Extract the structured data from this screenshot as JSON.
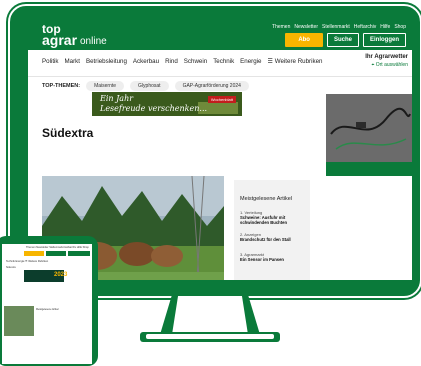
{
  "site": {
    "logo_top": "top",
    "logo_agrar": "agrar",
    "logo_online": "online",
    "top_links": [
      "Themen",
      "Newsletter",
      "Stellenmarkt",
      "Heftarchiv",
      "Hilfe",
      "Shop"
    ],
    "buttons": {
      "abo": "Abo",
      "search": "Suche",
      "login": "Einloggen"
    },
    "nav": [
      "Politik",
      "Markt",
      "Betriebsleitung",
      "Ackerbau",
      "Rind",
      "Schwein",
      "Technik",
      "Energie",
      "☰ Weitere Rubriken"
    ],
    "weather": {
      "title": "Ihr Agrarwetter",
      "sub": "Ort auswählen"
    },
    "top_themes_label": "TOP-THEMEN:",
    "top_themes": [
      "Maisernte",
      "Glyphosat",
      "GAP-Agrarförderung 2024"
    ],
    "banner": {
      "line1": "Ein Jahr",
      "line2": "Lesefreude verschenken...",
      "tag": "Wochenblatt"
    },
    "page_title": "Südextra",
    "most_read": {
      "title": "Meistgelesene Artikel",
      "items": [
        {
          "num": "1.",
          "kicker": "Verteilung",
          "headline": "Schweine: Ausfuhr mit schwindenden Buchten"
        },
        {
          "num": "2.",
          "kicker": "Anzeigen",
          "headline": "Brandschutz für den Stall"
        },
        {
          "num": "3.",
          "kicker": "Agrarmarkt",
          "headline": "Ein Sensor im Pansen"
        }
      ]
    }
  },
  "tablet": {
    "links": "Themen  Newsletter  Stellenmarkt  Heftarchiv  Hilfe  Shop",
    "nav": "Technik  Energie  ☰ Weitere Rubriken",
    "label": "Südextra",
    "year": "2023",
    "most_read": "Meistgelesene Artikel"
  },
  "colors": {
    "brand_green": "#0a7a3a",
    "accent_yellow": "#f7b500"
  }
}
